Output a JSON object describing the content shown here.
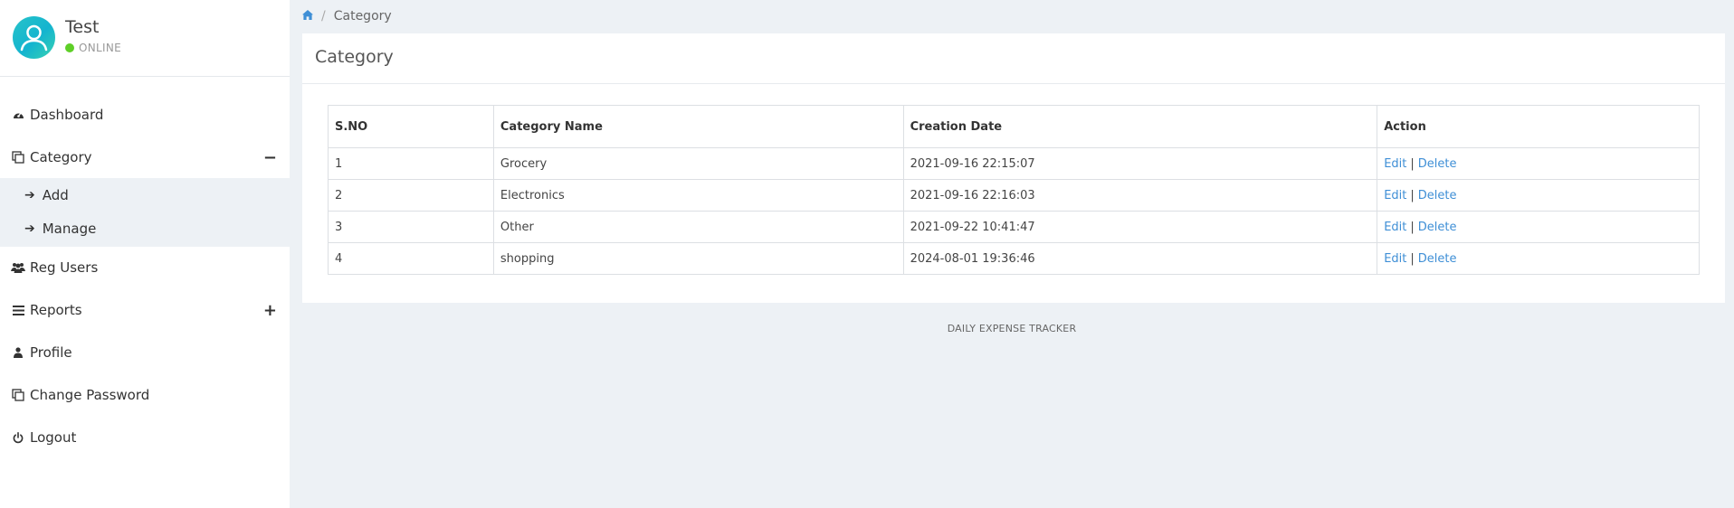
{
  "user": {
    "name": "Test",
    "status": "ONLINE"
  },
  "colors": {
    "online": "#5ecf27",
    "link": "#3f8fd6",
    "background": "#edf1f5"
  },
  "sidebar": {
    "items": [
      {
        "label": "Dashboard",
        "icon": "dashboard-icon"
      },
      {
        "label": "Category",
        "icon": "copy-icon",
        "toggle": "−"
      },
      {
        "label": "Reg Users",
        "icon": "users-icon"
      },
      {
        "label": "Reports",
        "icon": "list-icon",
        "toggle": "+"
      },
      {
        "label": "Profile",
        "icon": "user-icon"
      },
      {
        "label": "Change Password",
        "icon": "copy-icon"
      },
      {
        "label": "Logout",
        "icon": "power-icon"
      }
    ],
    "submenu": [
      {
        "label": "Add",
        "icon": "arrow-right-icon"
      },
      {
        "label": "Manage",
        "icon": "arrow-right-icon"
      }
    ]
  },
  "breadcrumb": {
    "home_icon": "home-icon",
    "separator": "/",
    "current": "Category"
  },
  "panel": {
    "title": "Category"
  },
  "table": {
    "headers": [
      "S.NO",
      "Category Name",
      "Creation Date",
      "Action"
    ],
    "rows": [
      {
        "sno": "1",
        "name": "Grocery",
        "date": "2021-09-16 22:15:07"
      },
      {
        "sno": "2",
        "name": "Electronics",
        "date": "2021-09-16 22:16:03"
      },
      {
        "sno": "3",
        "name": "Other",
        "date": "2021-09-22 10:41:47"
      },
      {
        "sno": "4",
        "name": "shopping",
        "date": "2024-08-01 19:36:46"
      }
    ],
    "actions": {
      "edit": "Edit",
      "separator": "|",
      "delete": "Delete"
    }
  },
  "footer": {
    "text": "DAILY EXPENSE TRACKER"
  }
}
